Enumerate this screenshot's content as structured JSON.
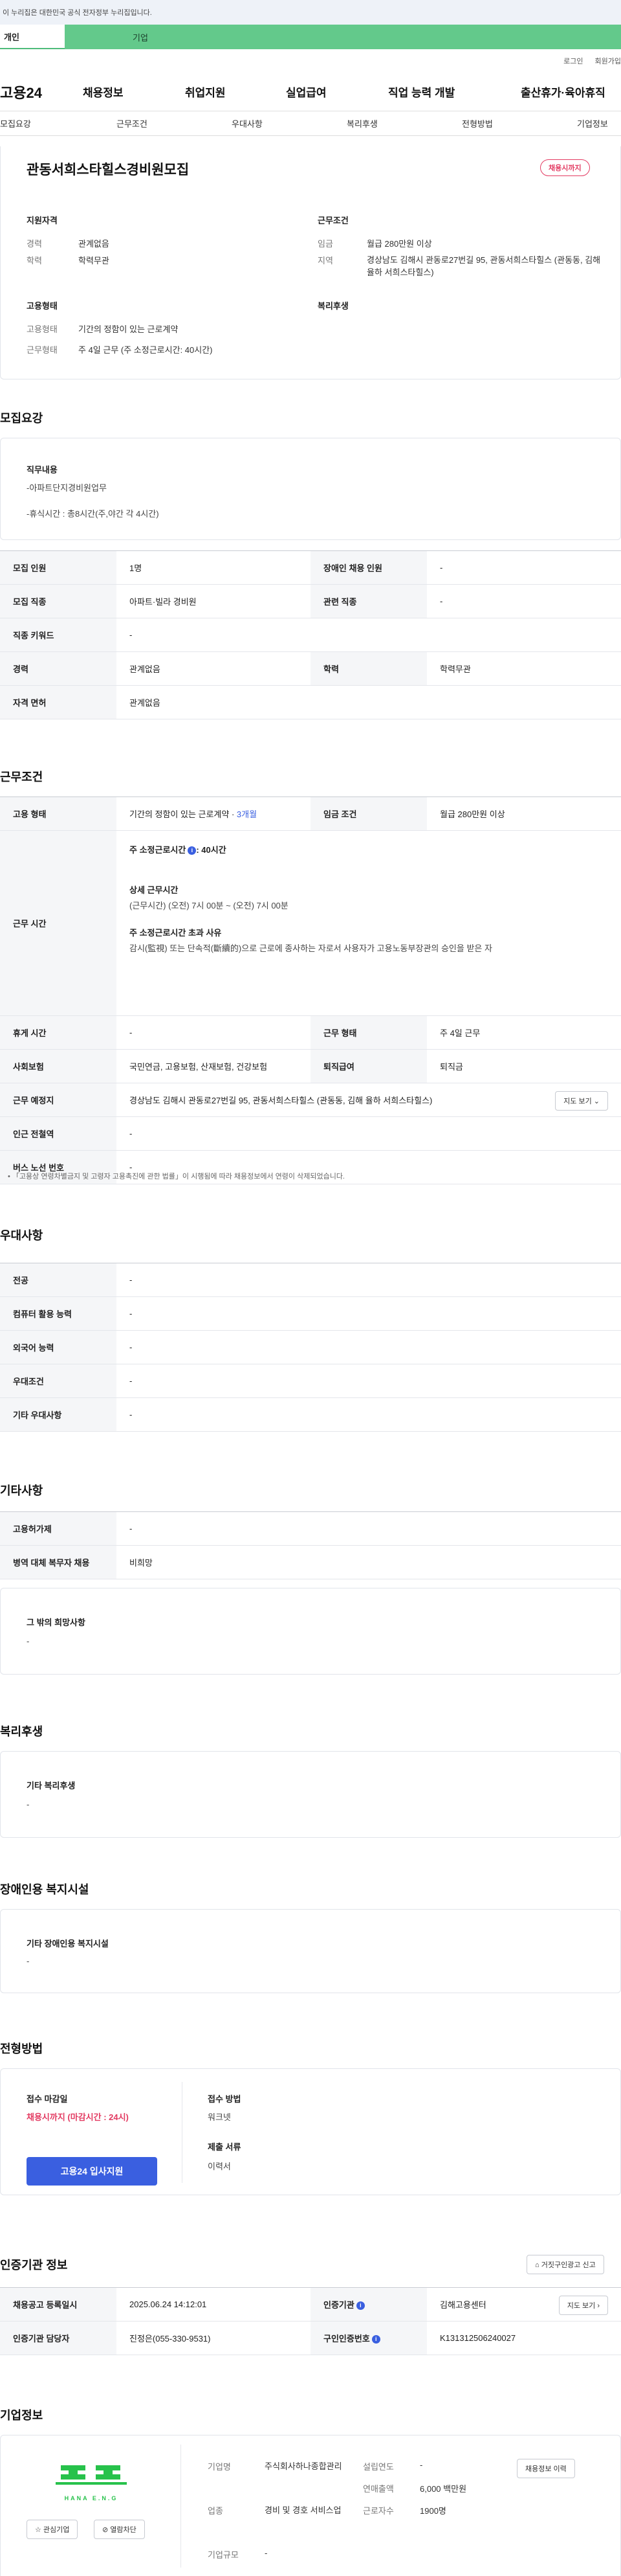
{
  "header": {
    "gov_notice": "이 누리집은 대한민국 공식 전자정부 누리집입니다.",
    "user_tabs": {
      "personal": "개인",
      "company": "기업"
    },
    "util": {
      "login": "로그인",
      "signup": "회원가입"
    },
    "logo": "고용24",
    "gnb": [
      "채용정보",
      "취업지원",
      "실업급여",
      "직업 능력 개발",
      "출산휴가·육아휴직"
    ]
  },
  "anchor_tabs": [
    "모집요강",
    "근무조건",
    "우대사항",
    "복리후생",
    "전형방법",
    "기업정보"
  ],
  "summary": {
    "title": "관동서희스타힐스경비원모집",
    "deadline_badge": "채용시까지",
    "qual_heading": "지원자격",
    "qual": [
      {
        "label": "경력",
        "value": "관계없음"
      },
      {
        "label": "학력",
        "value": "학력무관"
      }
    ],
    "cond_heading": "근무조건",
    "cond": [
      {
        "label": "임금",
        "value": "월급 280만원 이상"
      },
      {
        "label": "지역",
        "value": "경상남도 김해시 관동로27번길 95, 관동서희스타힐스 (관동동, 김해 율하 서희스타힐스)"
      }
    ],
    "emp_heading": "고용형태",
    "emp": [
      {
        "label": "고용형태",
        "value": "기간의 정함이 있는 근로계약"
      },
      {
        "label": "근무형태",
        "value": "주 4일 근무 (주 소정근로시간: 40시간)"
      }
    ],
    "welfare_heading": "복리후생"
  },
  "recruit": {
    "heading": "모집요강",
    "duty_heading": "직무내용",
    "duty_lines": [
      "-아파트단지경비원업무",
      "-휴식시간 :  총8시간(주,야간  각 4시간)"
    ],
    "rows": [
      {
        "l1": "모집 인원",
        "v1": "1명",
        "l2": "장애인 채용 인원",
        "v2": "-"
      },
      {
        "l1": "모집 직종",
        "v1": "아파트·빌라 경비원",
        "l2": "관련 직종",
        "v2": "-"
      },
      {
        "l1": "직종 키워드",
        "v1": "-"
      },
      {
        "l1": "경력",
        "v1": "관계없음",
        "l2": "학력",
        "v2": "학력무관"
      },
      {
        "l1": "자격 면허",
        "v1": "관계없음"
      }
    ]
  },
  "work": {
    "heading": "근무조건",
    "emp_type_label": "고용 형태",
    "emp_type_value": "기간의 정함이 있는 근로계약 · ",
    "emp_period": "3개월",
    "wage_label": "임금 조건",
    "wage_value": "월급 280만원 이상",
    "hours_label": "근무 시간",
    "hours_week": "주 소정근로시간",
    "hours_week_val": ": 40시간",
    "hours_detail_h": "상세 근무시간",
    "hours_detail": "(근무시간) (오전) 7시 00분 ~ (오전) 7시 00분",
    "overtime_h": "주 소정근로시간 초과 사유",
    "overtime": "감시(監視) 또는 단속적(斷續的)으로 근로에 종사하는 자로서 사용자가 고용노동부장관의 승인을 받은 자",
    "rows": [
      {
        "l1": "휴게 시간",
        "v1": "-",
        "l2": "근무 형태",
        "v2": "주 4일 근무"
      },
      {
        "l1": "사회보험",
        "v1": "국민연금, 고용보험, 산재보험, 건강보험",
        "l2": "퇴직급여",
        "v2": "퇴직금"
      }
    ],
    "location_label": "근무 예정지",
    "location_value": "경상남도 김해시 관동로27번길 95, 관동서희스타힐스 (관동동, 김해 율하 서희스타힐스)",
    "map_btn": "지도 보기",
    "subway_label": "인근 전철역",
    "subway_value": "-",
    "bus_label": "버스 노선 번호",
    "bus_value": "-",
    "footnote": "「고용상 연령차별금지 및 고령자 고용촉진에 관한 법률」이 시행됨에 따라 채용정보에서 연령이 삭제되었습니다."
  },
  "pref": {
    "heading": "우대사항",
    "rows": [
      {
        "label": "전공",
        "value": "-"
      },
      {
        "label": "컴퓨터 활용 능력",
        "value": "-"
      },
      {
        "label": "외국어 능력",
        "value": "-"
      },
      {
        "label": "우대조건",
        "value": "-"
      },
      {
        "label": "기타 우대사항",
        "value": "-"
      }
    ]
  },
  "etc": {
    "heading": "기타사항",
    "rows": [
      {
        "label": "고용허가제",
        "value": "-"
      },
      {
        "label": "병역 대체 복무자 채용",
        "value": "비희망"
      }
    ],
    "other_heading": "그 밖의 희망사항",
    "other_value": "-"
  },
  "welfare": {
    "heading": "복리후생",
    "box_h": "기타 복리후생",
    "box_v": "-"
  },
  "disabled": {
    "heading": "장애인용 복지시설",
    "box_h": "기타 장애인용 복지시설",
    "box_v": "-"
  },
  "process": {
    "heading": "전형방법",
    "deadline_h": "접수 마감일",
    "deadline_v": "채용시까지 (마감시간 : 24시)",
    "apply_btn": "고용24 입사지원",
    "method_h": "접수 방법",
    "method_v": "워크넷",
    "docs_h": "제출 서류",
    "docs_v": "이력서"
  },
  "agency": {
    "heading": "인증기관 정보",
    "report_btn": "거짓구인광고 신고",
    "rows": [
      {
        "l1": "채용공고 등록일시",
        "v1": "2025.06.24 14:12:01",
        "l2": "인증기관",
        "v2": "김해고용센터",
        "btn": "지도 보기"
      },
      {
        "l1": "인증기관 담당자",
        "v1": "진정은(055-330-9531)",
        "l2": "구인인증번호",
        "v2": "K131312506240027"
      }
    ]
  },
  "company": {
    "heading": "기업정보",
    "logo_text": "HANA E.N.G",
    "fav_btn": "관심기업",
    "block_btn": "열람차단",
    "fields": [
      {
        "label": "기업명",
        "value": "주식회사하나종합관리"
      },
      {
        "label": "업종",
        "value": "경비 및 경호 서비스업"
      },
      {
        "label": "기업규모",
        "value": "-"
      }
    ],
    "fields2": [
      {
        "label": "설립연도",
        "value": "-"
      },
      {
        "label": "연매출액",
        "value": "6,000 백만원"
      },
      {
        "label": "근로자수",
        "value": "1900명"
      }
    ],
    "jobs_btn": "채용정보 이력"
  }
}
